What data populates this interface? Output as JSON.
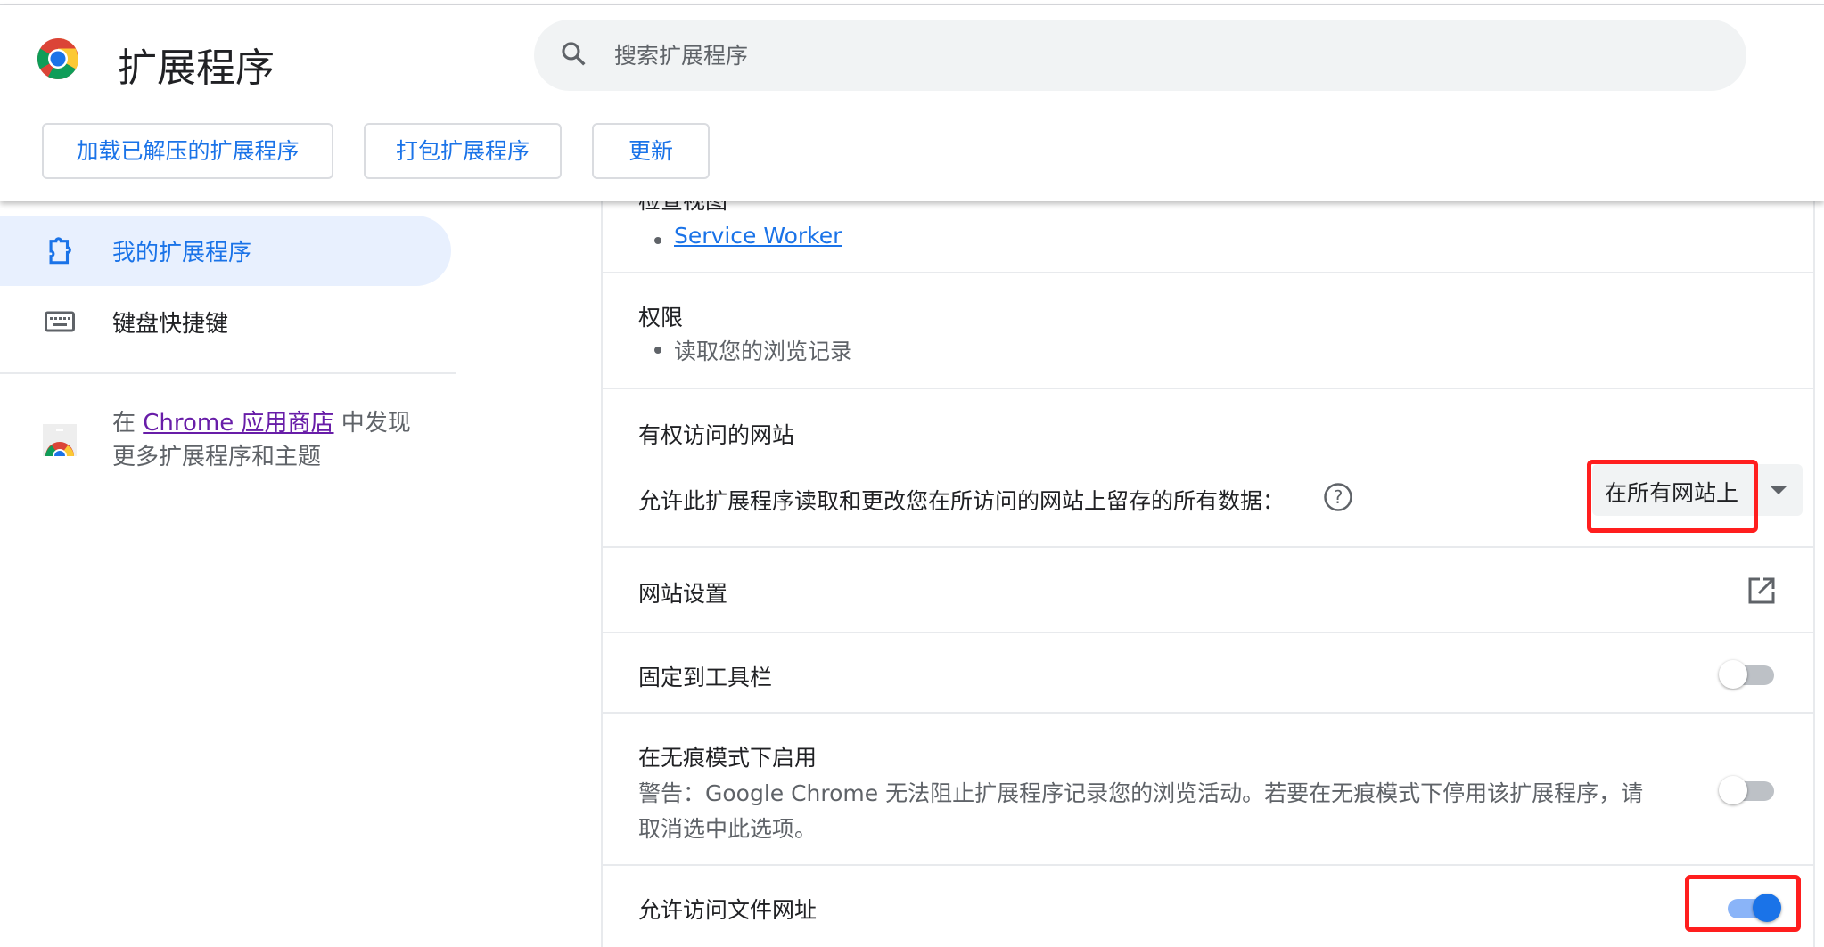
{
  "header": {
    "title": "扩展程序",
    "search_placeholder": "搜索扩展程序",
    "buttons": [
      "加载已解压的扩展程序",
      "打包扩展程序",
      "更新"
    ]
  },
  "sidebar": {
    "items": [
      {
        "label": "我的扩展程序",
        "active": true
      },
      {
        "label": "键盘快捷键",
        "active": false
      }
    ],
    "store": {
      "prefix": "在 ",
      "link": "Chrome 应用商店",
      "suffix": " 中发现",
      "line2": "更多扩展程序和主题"
    }
  },
  "details": {
    "inspect_views": {
      "label": "检查视图",
      "items": [
        "Service Worker"
      ]
    },
    "permissions": {
      "label": "权限",
      "items": [
        "读取您的浏览记录"
      ]
    },
    "site_access": {
      "label": "有权访问的网站",
      "description": "允许此扩展程序读取和更改您在所访问的网站上留存的所有数据：",
      "selected": "在所有网站上"
    },
    "site_settings": {
      "label": "网站设置"
    },
    "pin_toolbar": {
      "label": "固定到工具栏",
      "enabled": false
    },
    "incognito": {
      "label": "在无痕模式下启用",
      "warning_line1": "警告：Google Chrome 无法阻止扩展程序记录您的浏览活动。若要在无痕模式下停用该扩展程序，请",
      "warning_line2": "取消选中此选项。",
      "enabled": false
    },
    "file_urls": {
      "label": "允许访问文件网址",
      "enabled": true
    }
  },
  "colors": {
    "accent": "#1a73e8",
    "highlight": "#ff1e1e",
    "active_bg": "#e8f0fe"
  }
}
